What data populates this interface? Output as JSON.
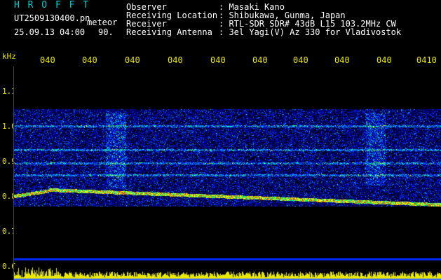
{
  "header": {
    "station": "H R O F F T",
    "filename": "UT2509130400.pn",
    "tag": "meteor",
    "datetime": "25.09.13 04:00",
    "value": "90.",
    "fields": [
      {
        "label": "Observer",
        "value": ": Masaki Kano"
      },
      {
        "label": "Receiving Location",
        "value": ": Shibukawa, Gunma, Japan"
      },
      {
        "label": "Receiver",
        "value": ": RTL-SDR SDR# 43dB L15 103.2MHz CW"
      },
      {
        "label": "Receiving Antenna",
        "value": ": 3el Yagi(V) Az 330 for Vladivostok"
      }
    ]
  },
  "axis": {
    "unit": "kHz",
    "y_labels": [
      "1.1",
      "1.0",
      "0.9",
      "0.8",
      "0.7",
      "0.6"
    ],
    "x_labels": [
      "040",
      "040",
      "040",
      "040",
      "040",
      "040",
      "040",
      "040",
      "040",
      "0410"
    ]
  },
  "colors": {
    "header_text": "#ffffff",
    "station": "#00d0d0",
    "axis_text": "#e8e800",
    "background": "#000000",
    "activity_bar": "#e8e800"
  }
}
